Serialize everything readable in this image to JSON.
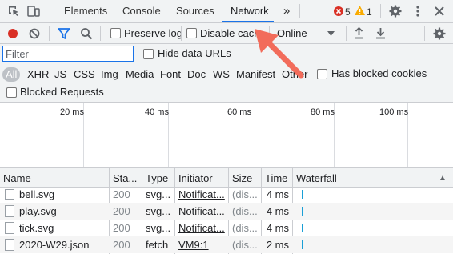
{
  "tabs": {
    "items": [
      "Elements",
      "Console",
      "Sources",
      "Network"
    ],
    "more": "»",
    "errors": "5",
    "warnings": "1"
  },
  "toolbar": {
    "preserve_log": "Preserve log",
    "disable_cache": "Disable cach",
    "throttle": "Online"
  },
  "filter": {
    "placeholder": "Filter",
    "hide_data_urls": "Hide data URLs",
    "types": [
      "All",
      "XHR",
      "JS",
      "CSS",
      "Img",
      "Media",
      "Font",
      "Doc",
      "WS",
      "Manifest",
      "Other"
    ],
    "has_blocked_cookies": "Has blocked cookies",
    "blocked_requests": "Blocked Requests"
  },
  "overview": {
    "ticks": [
      "20 ms",
      "40 ms",
      "60 ms",
      "80 ms",
      "100 ms"
    ]
  },
  "table": {
    "headers": [
      "Name",
      "Sta...",
      "Type",
      "Initiator",
      "Size",
      "Time",
      "Waterfall"
    ],
    "sort_indicator": "▲",
    "rows": [
      {
        "name": "bell.svg",
        "status": "200",
        "type": "svg...",
        "initiator": "Notificat...",
        "size": "(dis...",
        "time": "4 ms"
      },
      {
        "name": "play.svg",
        "status": "200",
        "type": "svg...",
        "initiator": "Notificat...",
        "size": "(dis...",
        "time": "4 ms"
      },
      {
        "name": "tick.svg",
        "status": "200",
        "type": "svg...",
        "initiator": "Notificat...",
        "size": "(dis...",
        "time": "4 ms"
      },
      {
        "name": "2020-W29.json",
        "status": "200",
        "type": "fetch",
        "initiator": "VM9:1",
        "size": "(dis...",
        "time": "2 ms"
      }
    ]
  },
  "colors": {
    "accent": "#1a73e8",
    "record": "#d93025",
    "error_badge": "#d93025",
    "warning_badge": "#f9ab00",
    "arrow": "#f26c5b",
    "waterfall_bar": "#1a9fd6"
  }
}
